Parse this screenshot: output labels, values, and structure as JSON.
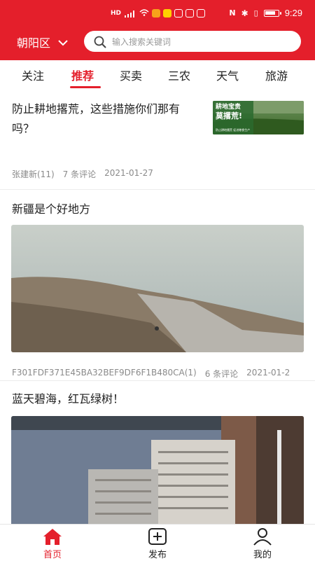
{
  "status_bar": {
    "time": "9:29",
    "left_badges": [
      "HD",
      "4G",
      "wifi",
      "美",
      "!",
      "⊙",
      "✉"
    ]
  },
  "header": {
    "location": "朝阳区",
    "search_placeholder": "输入搜索关键词"
  },
  "tabs": [
    {
      "label": "关注",
      "active": false
    },
    {
      "label": "推荐",
      "active": true
    },
    {
      "label": "买卖",
      "active": false
    },
    {
      "label": "三农",
      "active": false
    },
    {
      "label": "天气",
      "active": false
    },
    {
      "label": "旅游",
      "active": false
    }
  ],
  "posts": [
    {
      "title": "防止耕地撂荒，这些措施你们那有吗？",
      "thumb_caption": {
        "line1": "耕地宝贵",
        "line2": "莫撂荒!",
        "footer": "防止耕地撂荒 促进粮食生产"
      },
      "author": "张建新(11)",
      "comments": "7 条评论",
      "date": "2021-01-27"
    },
    {
      "title": "新疆是个好地方",
      "author": "F301FDF371E45BA32BEF9DF6F1B480CA(1)",
      "comments": "6 条评论",
      "date": "2021-01-2"
    },
    {
      "title": "蓝天碧海，红瓦绿树！"
    }
  ],
  "bottom_nav": [
    {
      "label": "首页",
      "active": true
    },
    {
      "label": "发布",
      "active": false
    },
    {
      "label": "我的",
      "active": false
    }
  ],
  "colors": {
    "brand": "#e41f2b",
    "meta_text": "#8a8a8a"
  }
}
